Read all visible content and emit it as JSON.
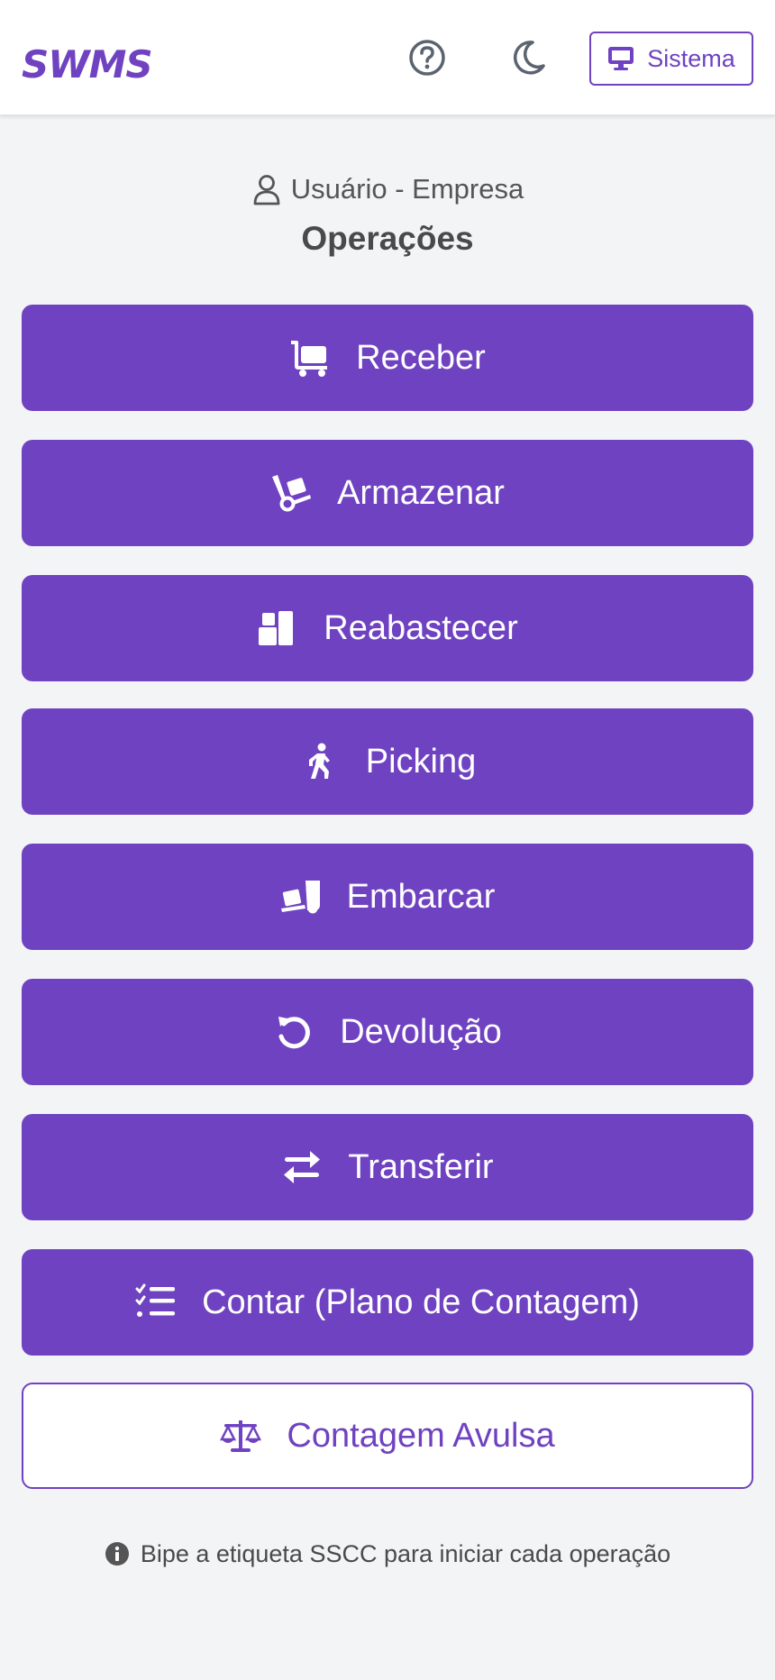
{
  "header": {
    "logo_text": "SWMS",
    "help_icon": "question-circle-icon",
    "theme_icon": "moon-icon",
    "system_button": {
      "label": "Sistema",
      "icon": "desktop-icon"
    }
  },
  "user": {
    "label": "Usuário - Empresa",
    "icon": "person-icon"
  },
  "page_title": "Operações",
  "operations": [
    {
      "label": "Receber",
      "icon": "cart-flatbed-icon"
    },
    {
      "label": "Armazenar",
      "icon": "dolly-icon"
    },
    {
      "label": "Reabastecer",
      "icon": "boxes-stacked-icon"
    },
    {
      "label": "Picking",
      "icon": "person-walking-icon"
    },
    {
      "label": "Embarcar",
      "icon": "truck-ramp-box-icon"
    },
    {
      "label": "Devolução",
      "icon": "rotate-left-icon"
    },
    {
      "label": "Transferir",
      "icon": "right-left-arrows-icon"
    },
    {
      "label": "Contar (Plano de Contagem)",
      "icon": "list-check-icon"
    },
    {
      "label": "Contagem Avulsa",
      "icon": "scale-balanced-icon"
    }
  ],
  "hint": {
    "text": "Bipe a etiqueta SSCC para iniciar cada operação",
    "icon": "info-circle-icon"
  },
  "colors": {
    "primary": "#6f42c1",
    "background": "#f3f4f6",
    "header": "#ffffff"
  }
}
